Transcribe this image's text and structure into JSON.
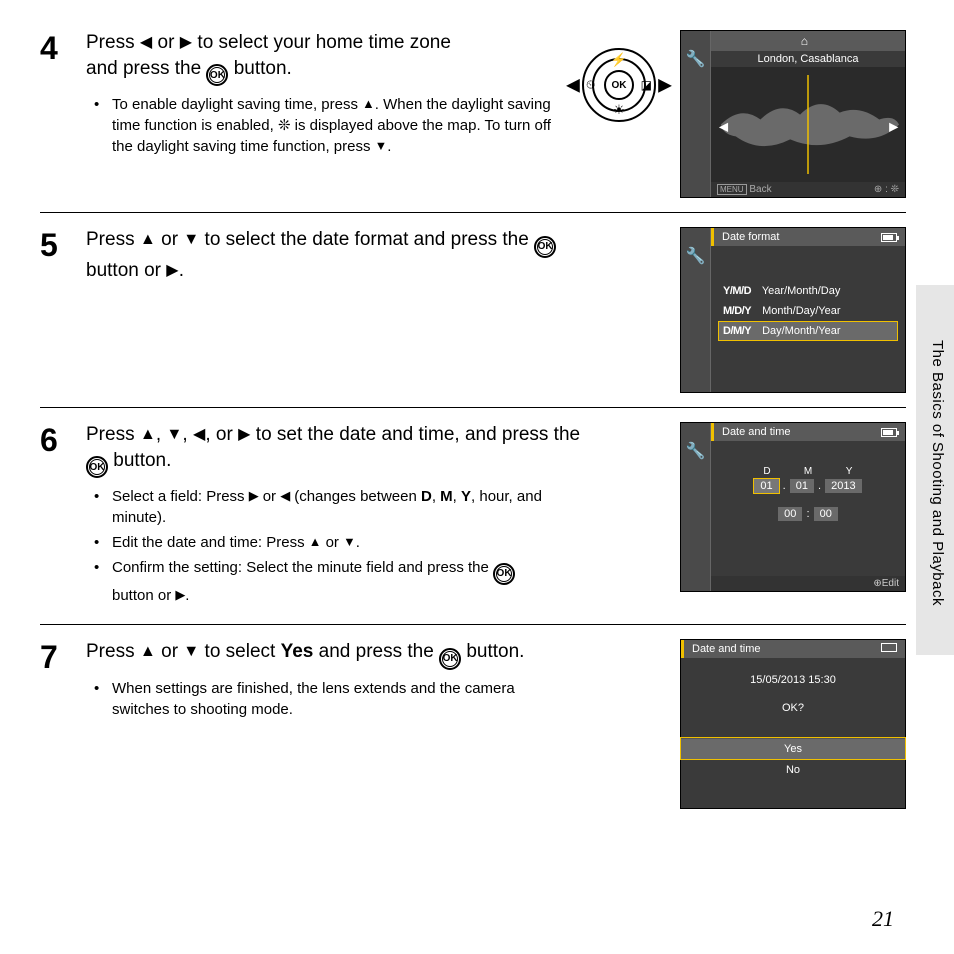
{
  "sideLabel": "The Basics of Shooting and Playback",
  "pageNumber": "21",
  "glyphs": {
    "left": "◀",
    "right": "▶",
    "up": "▲",
    "down": "▼",
    "ok": "OK",
    "back": "Back",
    "edit": "Edit"
  },
  "step4": {
    "num": "4",
    "headline_a": "Press ",
    "headline_b": " or ",
    "headline_c": " to select your home time zone and press the ",
    "headline_d": " button.",
    "bullet1_a": "To enable daylight saving time, press ",
    "bullet1_b": ". When the daylight saving time function is enabled, ",
    "bullet1_c": " is displayed above the map. To turn off the daylight saving time function, press ",
    "bullet1_d": ".",
    "screen": {
      "title": "London, Casablanca",
      "footer_left": "Back"
    }
  },
  "step5": {
    "num": "5",
    "headline_a": "Press ",
    "headline_b": " or ",
    "headline_c": " to select the date format and press the ",
    "headline_d": " button or ",
    "headline_e": ".",
    "screen": {
      "title": "Date format",
      "opt1_code": "Y/M/D",
      "opt1_label": "Year/Month/Day",
      "opt2_code": "M/D/Y",
      "opt2_label": "Month/Day/Year",
      "opt3_code": "D/M/Y",
      "opt3_label": "Day/Month/Year"
    }
  },
  "step6": {
    "num": "6",
    "headline_a": "Press ",
    "headline_b": ", ",
    "headline_c": ", ",
    "headline_d": ", or ",
    "headline_e": " to set the date and time, and press the ",
    "headline_f": " button.",
    "bullet1_a": "Select a field: Press ",
    "bullet1_b": " or ",
    "bullet1_c": " (changes between ",
    "bullet1_d": ", ",
    "bullet1_e": ", ",
    "bullet1_f": ", hour, and minute).",
    "bullet1_D": "D",
    "bullet1_M": "M",
    "bullet1_Y": "Y",
    "bullet2_a": "Edit the date and time: Press ",
    "bullet2_b": " or ",
    "bullet2_c": ".",
    "bullet3_a": "Confirm the setting: Select the minute field and press the ",
    "bullet3_b": " button or ",
    "bullet3_c": ".",
    "screen": {
      "title": "Date and time",
      "lbl_d": "D",
      "lbl_m": "M",
      "lbl_y": "Y",
      "val_d": "01",
      "val_m": "01",
      "val_y": "2013",
      "val_hh": "00",
      "val_mm": "00",
      "footer": "Edit"
    }
  },
  "step7": {
    "num": "7",
    "headline_a": "Press ",
    "headline_b": " or ",
    "headline_c": " to select ",
    "headline_yes": "Yes",
    "headline_d": " and press the ",
    "headline_e": " button.",
    "bullet1": "When settings are finished, the lens extends and the camera switches to shooting mode.",
    "screen": {
      "title": "Date and time",
      "datetime": "15/05/2013  15:30",
      "prompt": "OK?",
      "yes": "Yes",
      "no": "No"
    }
  }
}
